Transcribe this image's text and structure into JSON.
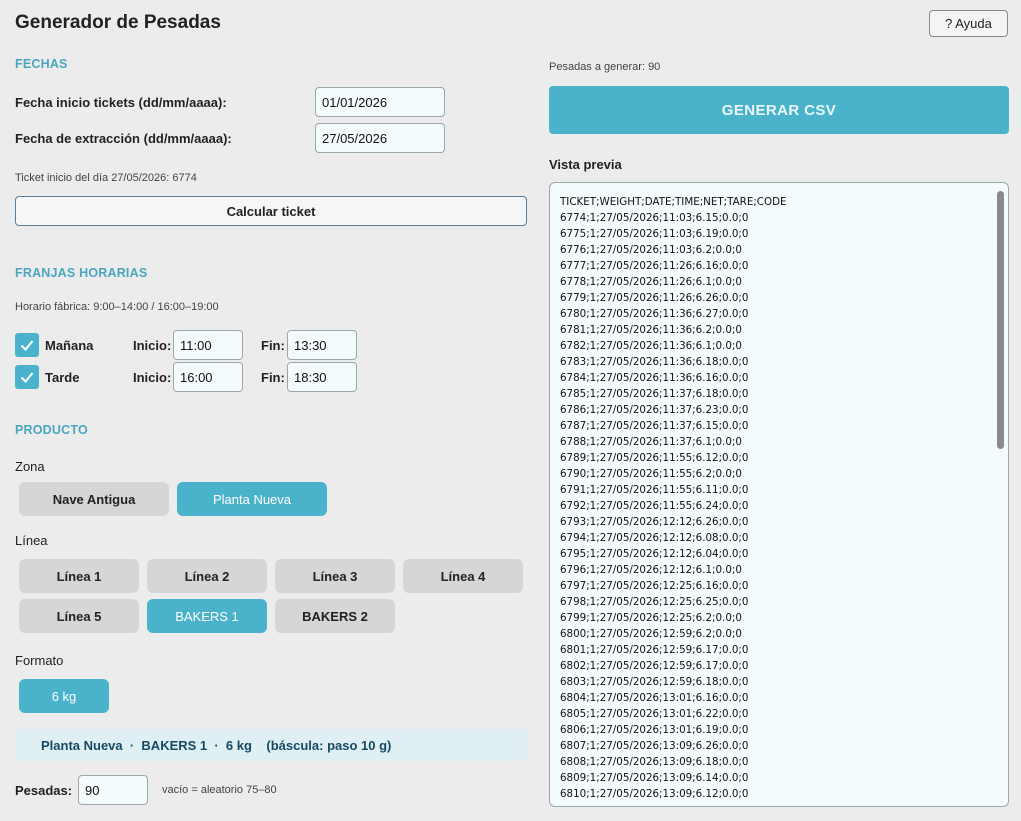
{
  "app": {
    "title": "Generador de Pesadas",
    "help_label": "? Ayuda"
  },
  "fechas": {
    "section_title": "FECHAS",
    "inicio_label": "Fecha inicio tickets (dd/mm/aaaa):",
    "inicio_value": "01/01/2026",
    "extraccion_label": "Fecha de extracción (dd/mm/aaaa):",
    "extraccion_value": "27/05/2026",
    "ticket_info": "Ticket inicio del día 27/05/2026: 6774",
    "calc_label": "Calcular ticket"
  },
  "franjas": {
    "section_title": "FRANJAS HORARIAS",
    "horario_info": "Horario fábrica: 9:00–14:00 / 16:00–19:00",
    "inicio_label": "Inicio:",
    "fin_label": "Fin:",
    "manana": {
      "label": "Mañana",
      "checked": true,
      "inicio": "11:00",
      "fin": "13:30"
    },
    "tarde": {
      "label": "Tarde",
      "checked": true,
      "inicio": "16:00",
      "fin": "18:30"
    }
  },
  "producto": {
    "section_title": "PRODUCTO",
    "zona_label": "Zona",
    "zonas": [
      "Nave Antigua",
      "Planta Nueva"
    ],
    "zona_selected": "Planta Nueva",
    "linea_label": "Línea",
    "lineas": [
      "Línea 1",
      "Línea 2",
      "Línea 3",
      "Línea 4",
      "Línea 5",
      "BAKERS 1",
      "BAKERS 2"
    ],
    "linea_selected": "BAKERS 1",
    "formato_label": "Formato",
    "formatos": [
      "6 kg"
    ],
    "formato_selected": "6 kg",
    "summary": "Planta Nueva  ·  BAKERS 1  ·  6 kg    (báscula: paso 10 g)"
  },
  "pesadas": {
    "label": "Pesadas:",
    "value": "90",
    "hint": "vacío = aleatorio 75–80"
  },
  "right": {
    "count_label": "Pesadas a generar: 90",
    "generate_label": "GENERAR CSV",
    "preview_title": "Vista previa",
    "preview_lines": [
      "TICKET;WEIGHT;DATE;TIME;NET;TARE;CODE",
      "6774;1;27/05/2026;11:03;6.15;0.0;0",
      "6775;1;27/05/2026;11:03;6.19;0.0;0",
      "6776;1;27/05/2026;11:03;6.2;0.0;0",
      "6777;1;27/05/2026;11:26;6.16;0.0;0",
      "6778;1;27/05/2026;11:26;6.1;0.0;0",
      "6779;1;27/05/2026;11:26;6.26;0.0;0",
      "6780;1;27/05/2026;11:36;6.27;0.0;0",
      "6781;1;27/05/2026;11:36;6.2;0.0;0",
      "6782;1;27/05/2026;11:36;6.1;0.0;0",
      "6783;1;27/05/2026;11:36;6.18;0.0;0",
      "6784;1;27/05/2026;11:36;6.16;0.0;0",
      "6785;1;27/05/2026;11:37;6.18;0.0;0",
      "6786;1;27/05/2026;11:37;6.23;0.0;0",
      "6787;1;27/05/2026;11:37;6.15;0.0;0",
      "6788;1;27/05/2026;11:37;6.1;0.0;0",
      "6789;1;27/05/2026;11:55;6.12;0.0;0",
      "6790;1;27/05/2026;11:55;6.2;0.0;0",
      "6791;1;27/05/2026;11:55;6.11;0.0;0",
      "6792;1;27/05/2026;11:55;6.24;0.0;0",
      "6793;1;27/05/2026;12:12;6.26;0.0;0",
      "6794;1;27/05/2026;12:12;6.08;0.0;0",
      "6795;1;27/05/2026;12:12;6.04;0.0;0",
      "6796;1;27/05/2026;12:12;6.1;0.0;0",
      "6797;1;27/05/2026;12:25;6.16;0.0;0",
      "6798;1;27/05/2026;12:25;6.25;0.0;0",
      "6799;1;27/05/2026;12:25;6.2;0.0;0",
      "6800;1;27/05/2026;12:59;6.2;0.0;0",
      "6801;1;27/05/2026;12:59;6.17;0.0;0",
      "6802;1;27/05/2026;12:59;6.17;0.0;0",
      "6803;1;27/05/2026;12:59;6.18;0.0;0",
      "6804;1;27/05/2026;13:01;6.16;0.0;0",
      "6805;1;27/05/2026;13:01;6.22;0.0;0",
      "6806;1;27/05/2026;13:01;6.19;0.0;0",
      "6807;1;27/05/2026;13:09;6.26;0.0;0",
      "6808;1;27/05/2026;13:09;6.18;0.0;0",
      "6809;1;27/05/2026;13:09;6.14;0.0;0",
      "6810;1;27/05/2026;13:09;6.12;0.0;0"
    ]
  }
}
